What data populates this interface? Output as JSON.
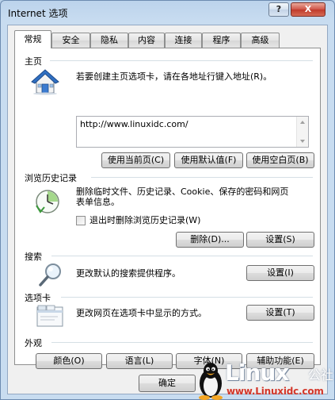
{
  "window": {
    "title": "Internet 选项",
    "help_label": "?",
    "close_label": "X"
  },
  "tabs": [
    {
      "label": "常规"
    },
    {
      "label": "安全"
    },
    {
      "label": "隐私"
    },
    {
      "label": "内容"
    },
    {
      "label": "连接"
    },
    {
      "label": "程序"
    },
    {
      "label": "高级"
    }
  ],
  "home": {
    "section_label": "主页",
    "description": "若要创建主页选项卡，请在各地址行键入地址(R)。",
    "url": "http://www.linuxidc.com/",
    "buttons": {
      "use_current": "使用当前页(C)",
      "use_default": "使用默认值(F)",
      "use_blank": "使用空白页(B)"
    }
  },
  "history": {
    "section_label": "浏览历史记录",
    "description_line1": "删除临时文件、历史记录、Cookie、保存的密码和网页",
    "description_line2": "表单信息。",
    "checkbox_label": "退出时删除浏览历史记录(W)",
    "checkbox_checked": false,
    "delete_button": "删除(D)...",
    "settings_button": "设置(S)"
  },
  "search": {
    "section_label": "搜索",
    "description": "更改默认的搜索提供程序。",
    "settings_button": "设置(I)"
  },
  "tabs_section": {
    "section_label": "选项卡",
    "description": "更改网页在选项卡中显示的方式。",
    "settings_button": "设置(T)"
  },
  "appearance": {
    "section_label": "外观",
    "buttons": {
      "colors": "颜色(O)",
      "languages": "语言(L)",
      "fonts": "字体(N)",
      "accessibility": "辅助功能(E)"
    }
  },
  "footer": {
    "ok_button": "确定"
  },
  "watermark": {
    "brand": "Linux",
    "brand_suffix": "公社",
    "url": "www.Linuxidc.com"
  }
}
